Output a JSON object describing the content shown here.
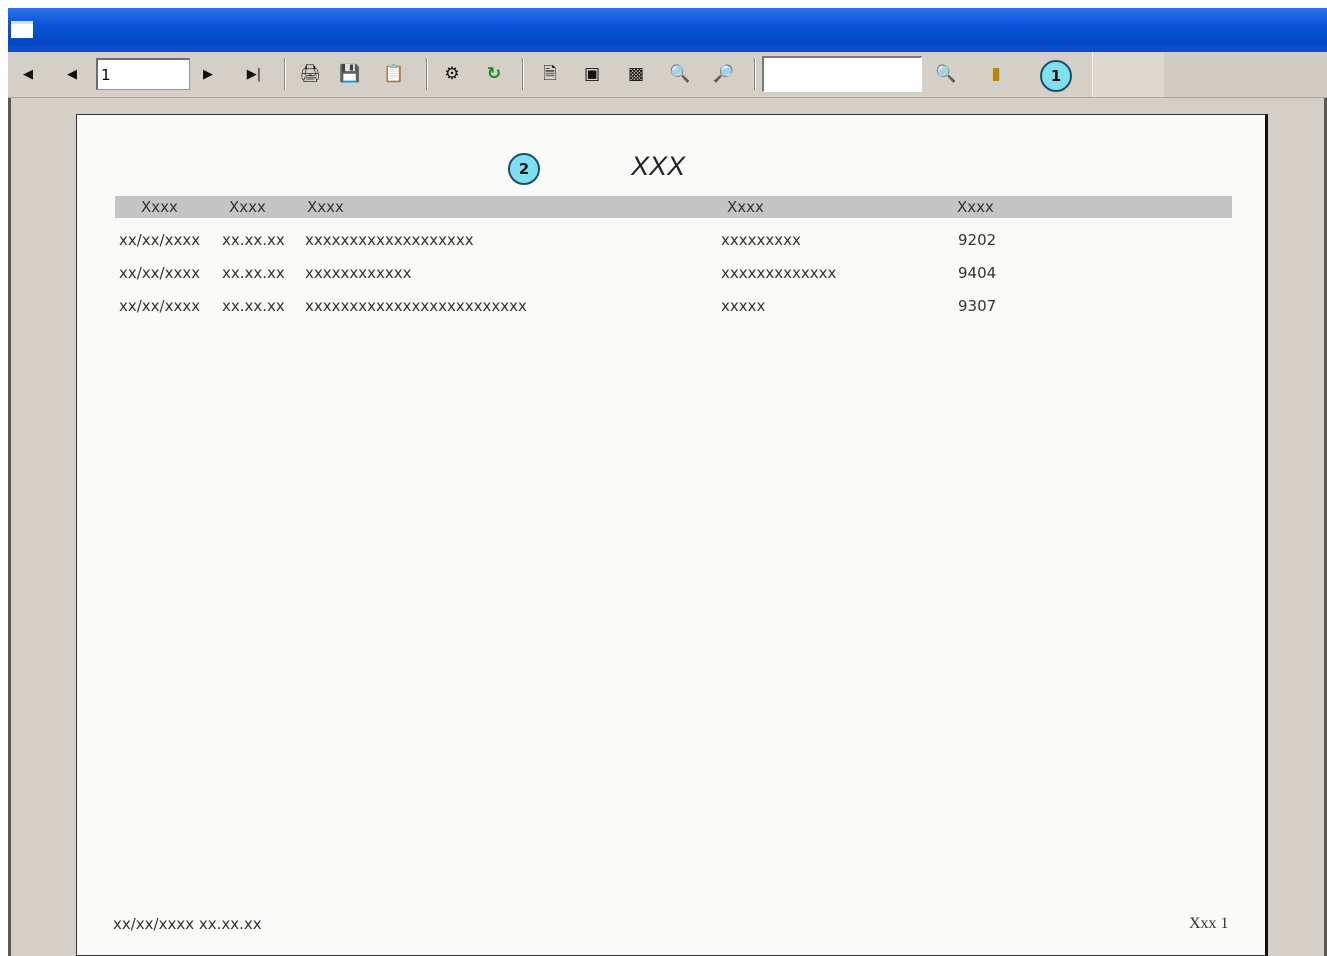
{
  "toolbar": {
    "page_number": "1",
    "search_value": "",
    "icons": [
      "first-page-icon",
      "previous-page-icon",
      "next-page-icon",
      "last-page-icon",
      "print-icon",
      "save-icon",
      "export-icon",
      "group-tree-icon",
      "refresh-icon",
      "page-width-icon",
      "whole-page-icon",
      "two-page-icon",
      "zoom-out-icon",
      "zoom-in-icon",
      "search-icon",
      "close-icon"
    ],
    "callout_1": "1"
  },
  "report": {
    "callout_2": "2",
    "title": "XXX",
    "headers": [
      "Xxxx",
      "Xxxx",
      "Xxxx",
      "Xxxx",
      "Xxxx"
    ],
    "rows": [
      {
        "date": "xx/xx/xxxx",
        "time": "xx.xx.xx",
        "desc": "xxxxxxxxxxxxxxxxxxx",
        "code": "xxxxxxxxx",
        "num": "9202"
      },
      {
        "date": "xx/xx/xxxx",
        "time": "xx.xx.xx",
        "desc": "xxxxxxxxxxxx",
        "code": "xxxxxxxxxxxxx",
        "num": "9404"
      },
      {
        "date": "xx/xx/xxxx",
        "time": "xx.xx.xx",
        "desc": "xxxxxxxxxxxxxxxxxxxxxxxxx",
        "code": "xxxxx",
        "num": "9307"
      }
    ],
    "footer_left": "xx/xx/xxxx  xx.xx.xx",
    "footer_right": "Xxx 1"
  }
}
